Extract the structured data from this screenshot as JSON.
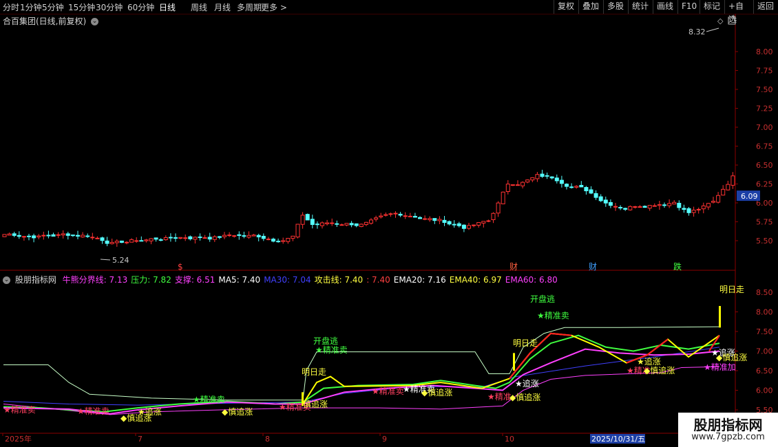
{
  "toolbar": {
    "periods": [
      "分时",
      "1分钟",
      "5分钟",
      "15分钟",
      "30分钟",
      "60分钟",
      "日线",
      "周线",
      "月线",
      "多周期",
      "更多 >"
    ],
    "active": "日线",
    "right_buttons": [
      "复权",
      "叠加",
      "多股",
      "统计",
      "画线",
      "F10",
      "标记",
      "+自选",
      "返回"
    ]
  },
  "stock": {
    "title": "合百集团(日线,前复权)"
  },
  "price_chart": {
    "y_ticks": [
      "8.00",
      "7.75",
      "7.50",
      "7.25",
      "7.00",
      "6.75",
      "6.50",
      "6.25",
      "6.00",
      "5.75",
      "5.50"
    ],
    "current_price": "6.09",
    "high_label": "8.32",
    "low_label": "5.24",
    "event_markers": [
      {
        "text": "$",
        "color": "#ff4040"
      },
      {
        "text": "财",
        "color": "#ff6040"
      },
      {
        "text": "财",
        "color": "#40a0ff"
      },
      {
        "text": "跌",
        "color": "#40ff40"
      }
    ]
  },
  "indicator": {
    "name": "股朋指标网",
    "values": [
      {
        "text": "牛熊分界线: 7.13",
        "color": "#ff40ff"
      },
      {
        "text": "压力: 7.82",
        "color": "#40ff40"
      },
      {
        "text": "支撑: 6.51",
        "color": "#ff40ff"
      },
      {
        "text": "MA5: 7.40",
        "color": "#ffffff"
      },
      {
        "text": "MA30: 7.04",
        "color": "#4040ff"
      },
      {
        "text": "攻击线: 7.40",
        "color": "#ffff40"
      },
      {
        "text": ": 7.40",
        "color": "#ff4040"
      },
      {
        "text": "EMA20: 7.16",
        "color": "#ffffff"
      },
      {
        "text": "EMA40: 6.97",
        "color": "#ffff40"
      },
      {
        "text": "EMA60: 6.80",
        "color": "#ff40ff"
      }
    ],
    "y_ticks": [
      "8.50",
      "8.00",
      "7.50",
      "7.00",
      "6.50",
      "6.00",
      "5.50"
    ],
    "signals": [
      {
        "text": "★精准卖",
        "color": "#ff4060"
      },
      {
        "text": "★精准卖",
        "color": "#ff4060"
      },
      {
        "text": "◆慎追涨",
        "color": "#ffff40"
      },
      {
        "text": "★追涨",
        "color": "#ffff40"
      },
      {
        "text": "★精准卖",
        "color": "#40ff40"
      },
      {
        "text": "◆慎追涨",
        "color": "#ffff40"
      },
      {
        "text": "★精准卖",
        "color": "#ff4060"
      },
      {
        "text": "慎追涨",
        "color": "#ffff40"
      },
      {
        "text": "开盘逃",
        "color": "#40ff40"
      },
      {
        "text": "★精准卖",
        "color": "#40ff40"
      },
      {
        "text": "明日走",
        "color": "#ffff40"
      },
      {
        "text": "★精准卖",
        "color": "#ff4060"
      },
      {
        "text": "★精准卖",
        "color": "#ffffff"
      },
      {
        "text": "◆慎追涨",
        "color": "#ffff40"
      },
      {
        "text": "开盘逃",
        "color": "#40ff40"
      },
      {
        "text": "★精准卖",
        "color": "#40ff40"
      },
      {
        "text": "明日走",
        "color": "#ffff40"
      },
      {
        "text": "★追涨",
        "color": "#ffffff"
      },
      {
        "text": "★精准",
        "color": "#ff4060"
      },
      {
        "text": "◆慎追涨",
        "color": "#ffff40"
      },
      {
        "text": "★追涨",
        "color": "#ffff40"
      },
      {
        "text": "★精准",
        "color": "#ff4060"
      },
      {
        "text": "◆慎追涨",
        "color": "#ffff40"
      },
      {
        "text": "★追涨",
        "color": "#ffffff"
      },
      {
        "text": "◆慎追涨",
        "color": "#ffff40"
      },
      {
        "text": "★精准加",
        "color": "#ff40ff"
      },
      {
        "text": "明日走",
        "color": "#ffff40"
      }
    ]
  },
  "x_axis": {
    "labels": [
      "2025年",
      "7",
      "8",
      "9",
      "10"
    ],
    "cursor_date": "2025/10/31/五"
  },
  "watermark": {
    "title": "股朋指标网",
    "url": "www.7gpzb.com"
  }
}
